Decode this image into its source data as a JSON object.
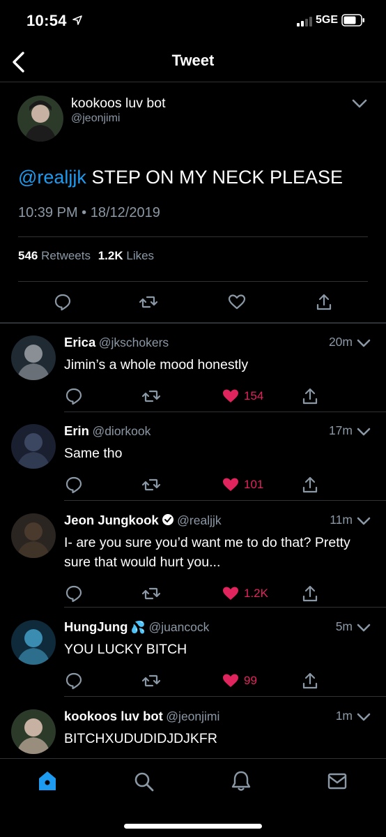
{
  "status_bar": {
    "time": "10:54",
    "network": "5GE"
  },
  "header": {
    "title": "Tweet"
  },
  "tweet": {
    "author_name": "kookoos luv bot",
    "author_handle": "@jeonjimi",
    "mention": "@realjjk",
    "text": " STEP ON MY NECK PLEASE",
    "timestamp": "10:39 PM • 18/12/2019",
    "retweets_count": "546",
    "retweets_label": "Retweets",
    "likes_count": "1.2K",
    "likes_label": "Likes"
  },
  "replies": [
    {
      "name": "Erica",
      "handle": "@jkschokers",
      "time": "20m",
      "text": "Jimin’s a whole mood honestly",
      "likes": "154",
      "verified": false,
      "emoji": ""
    },
    {
      "name": "Erin",
      "handle": "@diorkook",
      "time": "17m",
      "text": "Same tho",
      "likes": "101",
      "verified": false,
      "emoji": ""
    },
    {
      "name": "Jeon Jungkook",
      "handle": "@realjjk",
      "time": "11m",
      "text": "I- are you sure you’d want me to do that? Pretty sure that would hurt you...",
      "likes": "1.2K",
      "verified": true,
      "emoji": ""
    },
    {
      "name": "HungJung",
      "handle": "@juancock",
      "time": "5m",
      "text": "YOU LUCKY BITCH",
      "likes": "99",
      "verified": false,
      "emoji": "💦"
    },
    {
      "name": "kookoos luv bot",
      "handle": "@jeonjimi",
      "time": "1m",
      "text": "BITCHXUDUDIDJDJKFR",
      "likes": "",
      "verified": false,
      "emoji": ""
    }
  ],
  "colors": {
    "background": "#000000",
    "accent": "#1d9bf0",
    "like": "#e0245e",
    "muted": "#8b98a5"
  },
  "tab_bar": {
    "items": [
      "home-icon",
      "search-icon",
      "notifications-icon",
      "messages-icon"
    ]
  }
}
